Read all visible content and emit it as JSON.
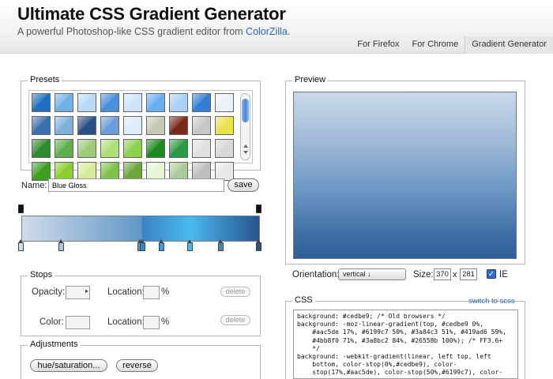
{
  "header": {
    "title": "Ultimate CSS Gradient Generator",
    "subtitle_text": "A powerful Photoshop-like CSS gradient editor from ",
    "subtitle_link": "ColorZilla",
    "subtitle_end": "."
  },
  "nav": {
    "tabs": [
      {
        "label": "For Firefox",
        "active": false
      },
      {
        "label": "For Chrome",
        "active": false
      },
      {
        "label": "Gradient Generator",
        "active": true
      }
    ]
  },
  "presets": {
    "legend": "Presets",
    "swatches": [
      "#1f6fc0",
      "#6fb0e8",
      "#b8dcf7",
      "#4a8fdc",
      "#cde4fb",
      "#6aaef2",
      "#a9d1f4",
      "#2f7fd5",
      "#e8f1fa",
      "#3a6fb0",
      "#7fb1dc",
      "#2a4f86",
      "#6a9ed8",
      "#dcecfb",
      "#c8c8b6",
      "#7a2a18",
      "#c8c8c8",
      "#e9e24a",
      "#2e8a2e",
      "#5fb04a",
      "#9ccc7a",
      "#aee07a",
      "#8fd050",
      "#1f8a1f",
      "#2c9a44",
      "#e1e1e1",
      "#d8d8d8",
      "#3f9f1f",
      "#8bd030",
      "#d6ec9a",
      "#7fc24a",
      "#6aa63a",
      "#e6f5d6",
      "#aacc99",
      "#bfbfbf",
      "#e8e8e8"
    ]
  },
  "name": {
    "label": "Name:",
    "value": "Blue Gloss",
    "save_label": "save"
  },
  "gradient": {
    "bottom_stops": [
      0,
      17,
      50,
      51,
      59,
      71,
      84,
      100
    ],
    "top_stops": [
      0,
      100
    ]
  },
  "stops_panel": {
    "legend": "Stops",
    "opacity_label": "Opacity:",
    "location_label": "Location:",
    "percent": "%",
    "color_label": "Color:",
    "delete_label": "delete",
    "arrow": "▸"
  },
  "adjustments": {
    "legend": "Adjustments",
    "hue_button": "hue/saturation...",
    "reverse_button": "reverse"
  },
  "preview": {
    "legend": "Preview",
    "orientation_label": "Orientation:",
    "orientation_value": "vertical  ↓",
    "size_label": "Size:",
    "width": "370",
    "x": "x",
    "height": "281",
    "ie_label": "IE",
    "ie_checked": "✓"
  },
  "css": {
    "legend": "CSS",
    "switch_link": "switch to scss",
    "code": "background: #cedbe9; /* Old browsers */\nbackground: -moz-linear-gradient(top, #cedbe9 0%,\n    #aac5de 17%, #6199c7 50%, #3a84c3 51%, #419ad6 59%,\n    #4bb8f0 71%, #3a8bc2 84%, #26558b 100%); /* FF3.6+\n    */\nbackground: -webkit-gradient(linear, left top, left\n    bottom, color-stop(0%,#cedbe9), color-\n    stop(17%,#aac5de), color-stop(50%,#6199c7), color-\n    stop(51%,#3a84c3), color-stop(59%,#419ad6), color-"
  },
  "colors": {
    "accent": "#2266bb",
    "gradient_start": "#cedbe9",
    "gradient_end": "#26558b"
  }
}
